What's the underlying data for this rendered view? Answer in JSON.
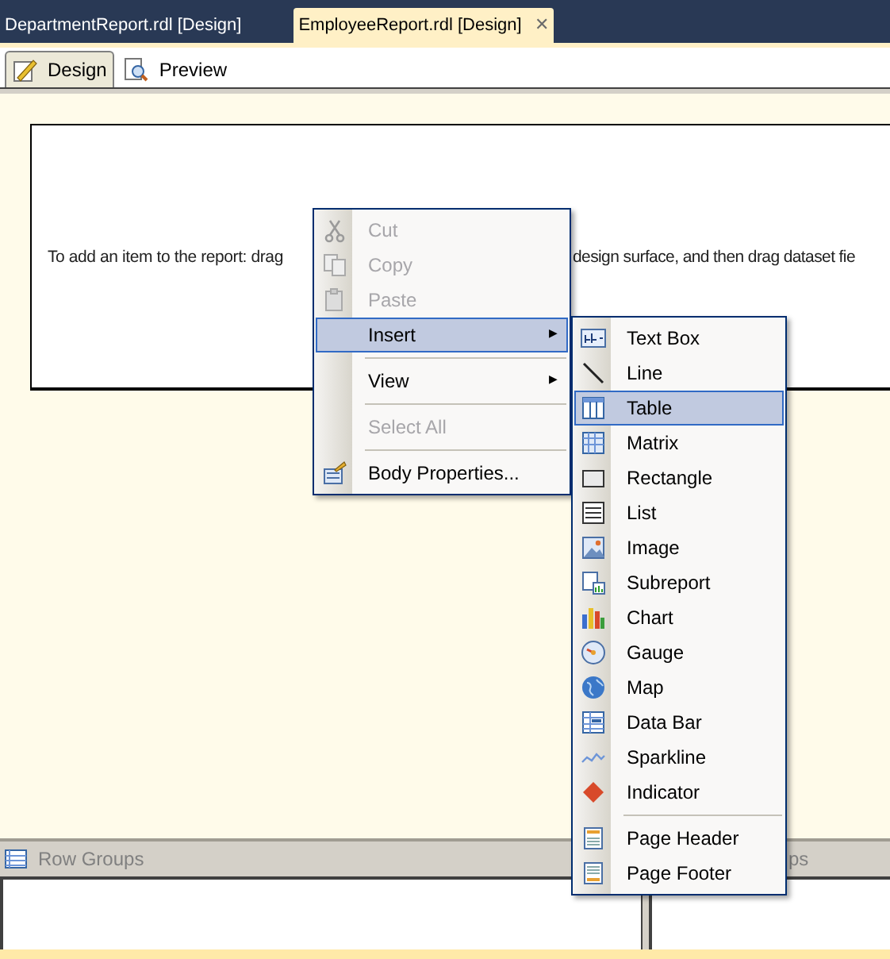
{
  "document_tabs": [
    {
      "label": "DepartmentReport.rdl [Design]",
      "selected": false,
      "closable": false
    },
    {
      "label": "EmployeeReport.rdl [Design]",
      "selected": true,
      "closable": true
    }
  ],
  "close_glyph": "✕",
  "view_tabs": [
    {
      "label": "Design",
      "selected": true
    },
    {
      "label": "Preview",
      "selected": false
    }
  ],
  "design_surface": {
    "hint_visible_left": "To add an item to the report: drag",
    "hint_visible_right": "design surface, and then drag dataset fie"
  },
  "context_menu": {
    "items": [
      {
        "kind": "item",
        "label": "Cut",
        "disabled": true,
        "selected": false,
        "has_submenu": false
      },
      {
        "kind": "item",
        "label": "Copy",
        "disabled": true,
        "selected": false,
        "has_submenu": false
      },
      {
        "kind": "item",
        "label": "Paste",
        "disabled": true,
        "selected": false,
        "has_submenu": false
      },
      {
        "kind": "item",
        "label": "Insert",
        "disabled": false,
        "selected": true,
        "has_submenu": true
      },
      {
        "kind": "separator"
      },
      {
        "kind": "item",
        "label": "View",
        "disabled": false,
        "selected": false,
        "has_submenu": true
      },
      {
        "kind": "separator"
      },
      {
        "kind": "item",
        "label": "Select All",
        "disabled": true,
        "selected": false,
        "has_submenu": false
      },
      {
        "kind": "separator"
      },
      {
        "kind": "item",
        "label": "Body Properties...",
        "disabled": false,
        "selected": false,
        "has_submenu": false
      }
    ]
  },
  "submenu_glyph": "▶",
  "insert_submenu": {
    "items": [
      {
        "kind": "item",
        "label": "Text Box",
        "selected": false
      },
      {
        "kind": "item",
        "label": "Line",
        "selected": false
      },
      {
        "kind": "item",
        "label": "Table",
        "selected": true
      },
      {
        "kind": "item",
        "label": "Matrix",
        "selected": false
      },
      {
        "kind": "item",
        "label": "Rectangle",
        "selected": false
      },
      {
        "kind": "item",
        "label": "List",
        "selected": false
      },
      {
        "kind": "item",
        "label": "Image",
        "selected": false
      },
      {
        "kind": "item",
        "label": "Subreport",
        "selected": false
      },
      {
        "kind": "item",
        "label": "Chart",
        "selected": false
      },
      {
        "kind": "item",
        "label": "Gauge",
        "selected": false
      },
      {
        "kind": "item",
        "label": "Map",
        "selected": false
      },
      {
        "kind": "item",
        "label": "Data Bar",
        "selected": false
      },
      {
        "kind": "item",
        "label": "Sparkline",
        "selected": false
      },
      {
        "kind": "item",
        "label": "Indicator",
        "selected": false
      },
      {
        "kind": "separator"
      },
      {
        "kind": "item",
        "label": "Page Header",
        "selected": false
      },
      {
        "kind": "item",
        "label": "Page Footer",
        "selected": false
      }
    ]
  },
  "grouping_pane": {
    "row_groups_label": "Row Groups",
    "column_groups_label_visible": "ps"
  }
}
